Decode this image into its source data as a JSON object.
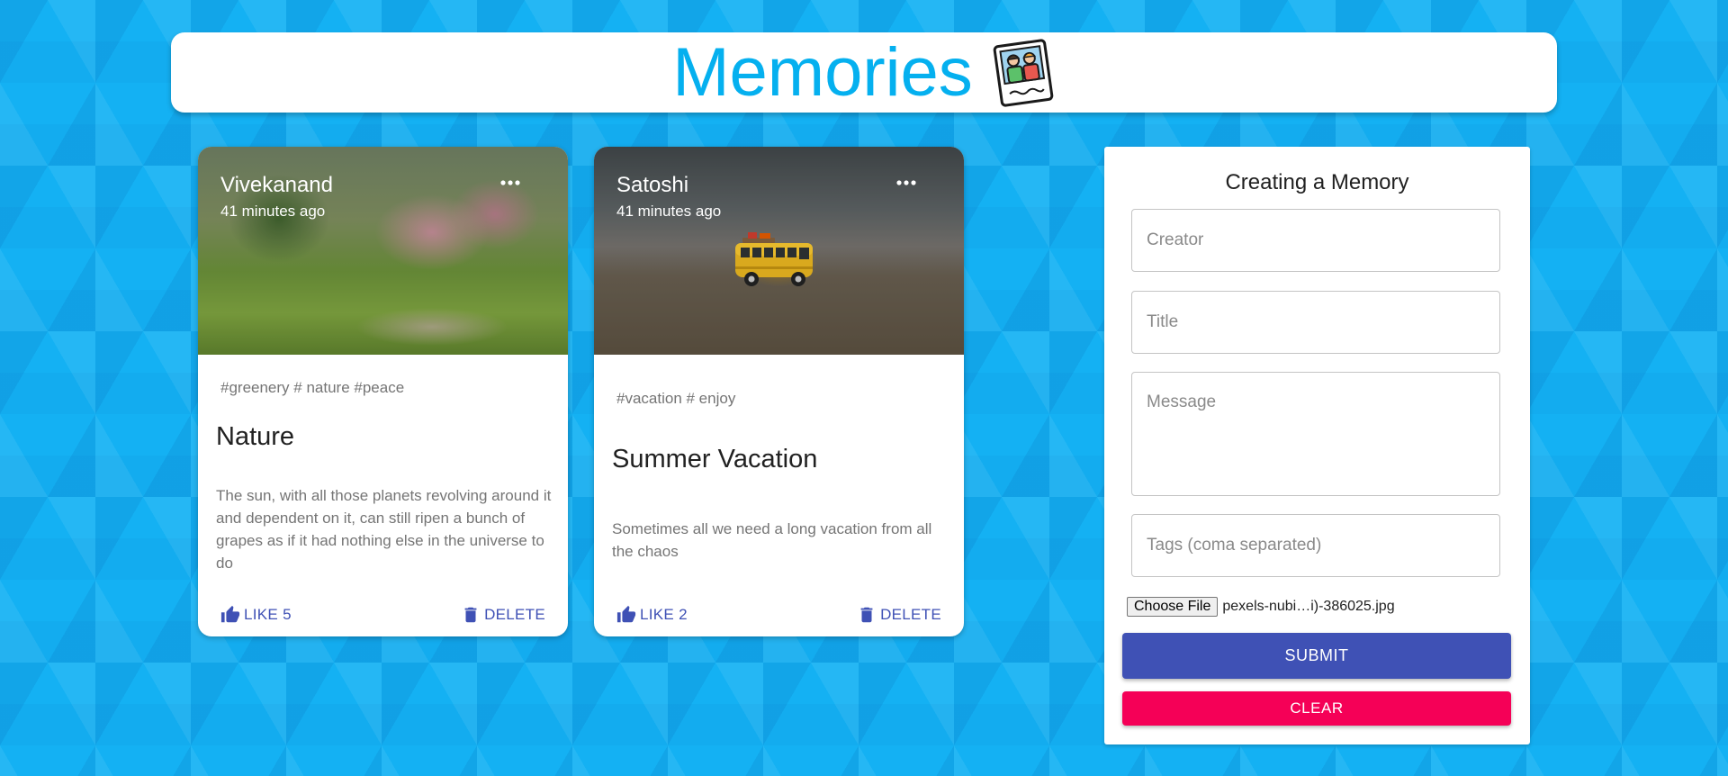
{
  "app": {
    "title": "Memories",
    "logo_icon": "photo-friends-icon"
  },
  "posts": [
    {
      "creator": "Vivekanand",
      "time": "41 minutes ago",
      "tags": "#greenery # nature #peace",
      "title": "Nature",
      "message": "The sun, with all those planets revolving around it and dependent on it, can still ripen a bunch of grapes as if it had nothing else in the universe to do",
      "like_label": "LIKE 5",
      "delete_label": "DELETE"
    },
    {
      "creator": "Satoshi",
      "time": "41 minutes ago",
      "tags": "#vacation # enjoy",
      "title": "Summer Vacation",
      "message": "Sometimes all we need a long vacation from all the chaos",
      "like_label": "LIKE 2",
      "delete_label": "DELETE"
    }
  ],
  "form": {
    "heading": "Creating a Memory",
    "creator_placeholder": "Creator",
    "title_placeholder": "Title",
    "message_placeholder": "Message",
    "tags_placeholder": "Tags (coma separated)",
    "file_button": "Choose File",
    "file_name": "pexels-nubi…i)-386025.jpg",
    "submit_label": "SUBMIT",
    "clear_label": "CLEAR"
  },
  "colors": {
    "background": "#14b1f3",
    "accent_title": "#05b0ef",
    "primary": "#3f51b5",
    "secondary": "#f50057"
  }
}
